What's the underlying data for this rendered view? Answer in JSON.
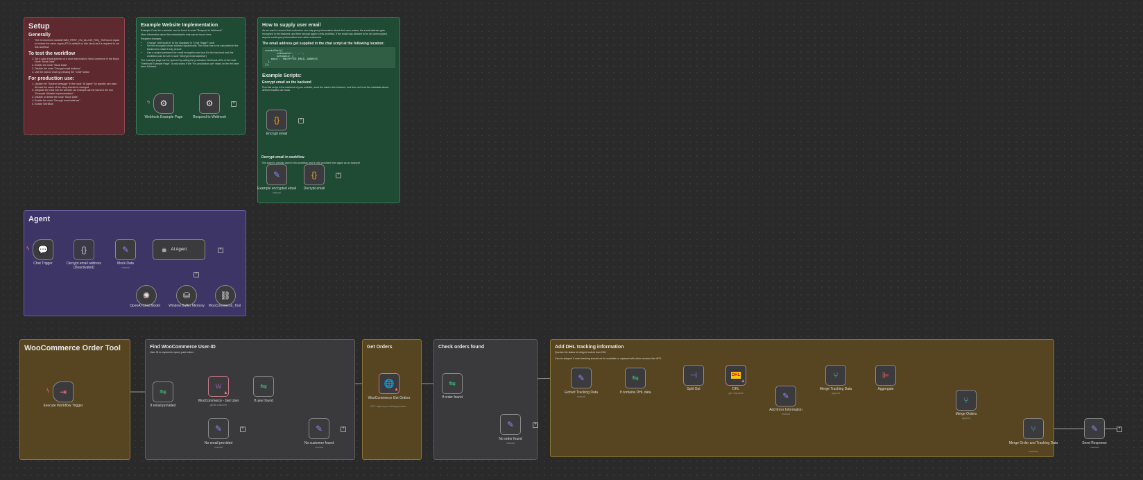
{
  "setup": {
    "title": "Setup",
    "generally": "Generally",
    "generally_items": [
      "The environment variable N8N_FIRST_CM_ALLOW_REQ_TIM has to equal to include the value crypto (FF) is default on n8n cloud as it is required to run this workflow"
    ],
    "test_title": "To test the workflow",
    "test_items": [
      "Set a valid email address of a user that exists in WooCommerce in the Mock Node \"Mock Data\"",
      "Enable the node \"Mock Data\"",
      "Disable the node \"Decrypt email address\"",
      "Use the built-in chat by pressing the \"Chat\" button"
    ],
    "prod_title": "For production use:",
    "prod_items": [
      "Update the \"System Message\" in the node \"AI Agent\" for specific use case. At least the name of the shop should be changed",
      "Integrate the chat into the website. An example can be found in the box \"Example Website Implementation\"",
      "Disable or delete the node \"Mock Data\"",
      "Enable the node \"Decrypt email address\"",
      "Enable Workflow"
    ]
  },
  "website": {
    "title": "Example Website Implementation",
    "p1": "Example Code for a website can be found in node \"Respond to Webhook\".",
    "p2": "More information about the embeddable chat can be found here.",
    "req": "Required changes:",
    "items": [
      "Change \"webhookUrl\" to the displayed in \"Chat Trigger\" node",
      "Set the encrypted email address dynamically. The value has to be calculated in the backend to make it truly secure",
      "Use a unique password for email encryption and use it in the backend and this workflow (can be set in node \"Decrypt email address\")"
    ],
    "p3": "The example page can be opened by calling the production Webhook-URL of the node \"Webhook Example Page\". It only works if the \"For production use\" steps on the left have been followed.",
    "nodes": {
      "webhook": "Webhook Example Page",
      "respond": "Respond to Webhook"
    }
  },
  "email": {
    "title": "How to supply user email",
    "p1": "As we want to ensure that customers can only query information about their own orders, the email address gets encrypted in the backend, and then decrypt again in this workflow. If the email was allowed to be set unencrypted, anyone could query information from other customers.",
    "p2": "The email address get supplied in the chat script at the following location:",
    "code": "createChat({\n        webhookUrl: '...',\n        metadata: {\n    email: 'ENCRYPTED_EMAIL_ADDRESS'\n  },\n});",
    "scripts": "Example Scripts:",
    "enc_title": "Encrypt email on the backend",
    "enc_text": "Run this script in the backend of your website, send the data to the frontend, and then set it as the metadata above defined location as email.",
    "enc_node": "Encrypt email",
    "dec_title": "Decrypt email in workflow",
    "dec_text": "This script is already used in this workflow and is only provided here again as an example",
    "ex_node": "Example encrypted email",
    "ex_sub": "manual",
    "dec_node": "Decrypt email"
  },
  "agent": {
    "title": "Agent",
    "nodes": {
      "chat": "Chat Trigger",
      "decrypt": "Decrypt email address (Deactivated)",
      "mock": "Mock Data",
      "mock_sub": "manual",
      "ai": "AI Agent",
      "openai": "OpenAI Chat Model",
      "memory": "Window Buffer Memory",
      "tool": "WooCommerce_Tool"
    },
    "ports": [
      "Chat Model*",
      "Memory",
      "Tool"
    ]
  },
  "tool": {
    "title": "WooCommerce Order Tool",
    "trigger": "Execute Workflow Trigger"
  },
  "find": {
    "title": "Find WooCommerce User-ID",
    "text": "User-ID is required to query past orders",
    "if_email": "If email provided",
    "woo_user": "WooCommerce - Get User",
    "woo_user_sub": "get:all customer",
    "if_user": "If user found",
    "no_email": "No email provided",
    "no_email_sub": "manual",
    "no_customer": "No customer found",
    "no_customer_sub": "manual"
  },
  "orders": {
    "title": "Get Orders",
    "node": "WooCommerce Get Orders",
    "sub": "GET: https://your-site/wp-json/wc..."
  },
  "check": {
    "title": "Check orders found",
    "if": "If order found",
    "none": "No order found",
    "none_sub": "manual"
  },
  "dhl": {
    "title": "Add DHL tracking information",
    "p1": "Queries the status of shipped orders from DHL",
    "p2": "Can be skipped if order tracking should not be available or replaced with other services like UPS.",
    "extract": "Extract Tracking Data",
    "extract_sub": "manual",
    "contains": "If contains DHL data",
    "split": "Split Out",
    "dhl": "DHL",
    "dhl_sub": "get: shipment",
    "error": "Add Error Information",
    "error_sub": "manual",
    "merge_track": "Merge Tracking Data",
    "merge_track_sub": "append",
    "aggregate": "Aggregate",
    "merge_orders": "Merge Orders",
    "merge_orders_sub": "append",
    "merge_final": "Merge Order and Tracking Data",
    "merge_final_sub": "combine",
    "send": "Send Response",
    "send_sub": "manual"
  },
  "colors": {
    "red_note": "#5e2a30",
    "green_note": "#1f4b35",
    "purple_note": "#3d3566",
    "brown_note": "#564520",
    "gray_note": "#3a3a3c",
    "wire": "#9a9a9a"
  }
}
